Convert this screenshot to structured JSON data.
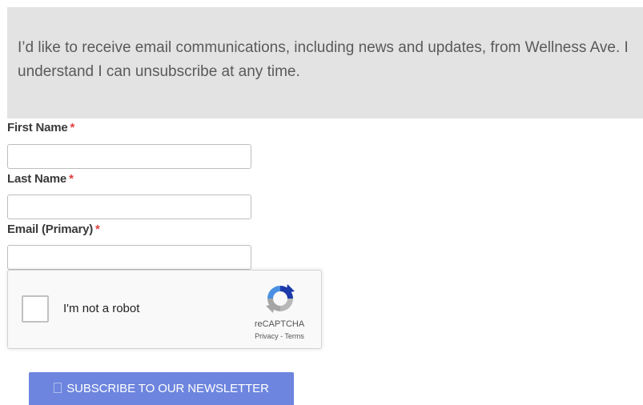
{
  "notice": {
    "text": "I’d like to receive email communications, including news and updates, from Wellness Ave. I understand I can unsubscribe at any time."
  },
  "form": {
    "required_mark": "*",
    "first_name": {
      "label": "First Name",
      "value": ""
    },
    "last_name": {
      "label": "Last Name",
      "value": ""
    },
    "email": {
      "label": "Email (Primary)",
      "value": ""
    }
  },
  "captcha": {
    "label": "I'm not a robot",
    "brand": "reCAPTCHA",
    "privacy": "Privacy",
    "separator": " - ",
    "terms": "Terms",
    "checked": false
  },
  "subscribe": {
    "label": "SUBSCRIBE TO OUR NEWSLETTER",
    "icon": "envelope-icon"
  },
  "colors": {
    "notice_bg": "#e3e3e3",
    "required": "#e0403f",
    "button_bg": "#6d85de",
    "captcha_blue": "#4a90e2",
    "captcha_gray": "#b7b7b7"
  }
}
